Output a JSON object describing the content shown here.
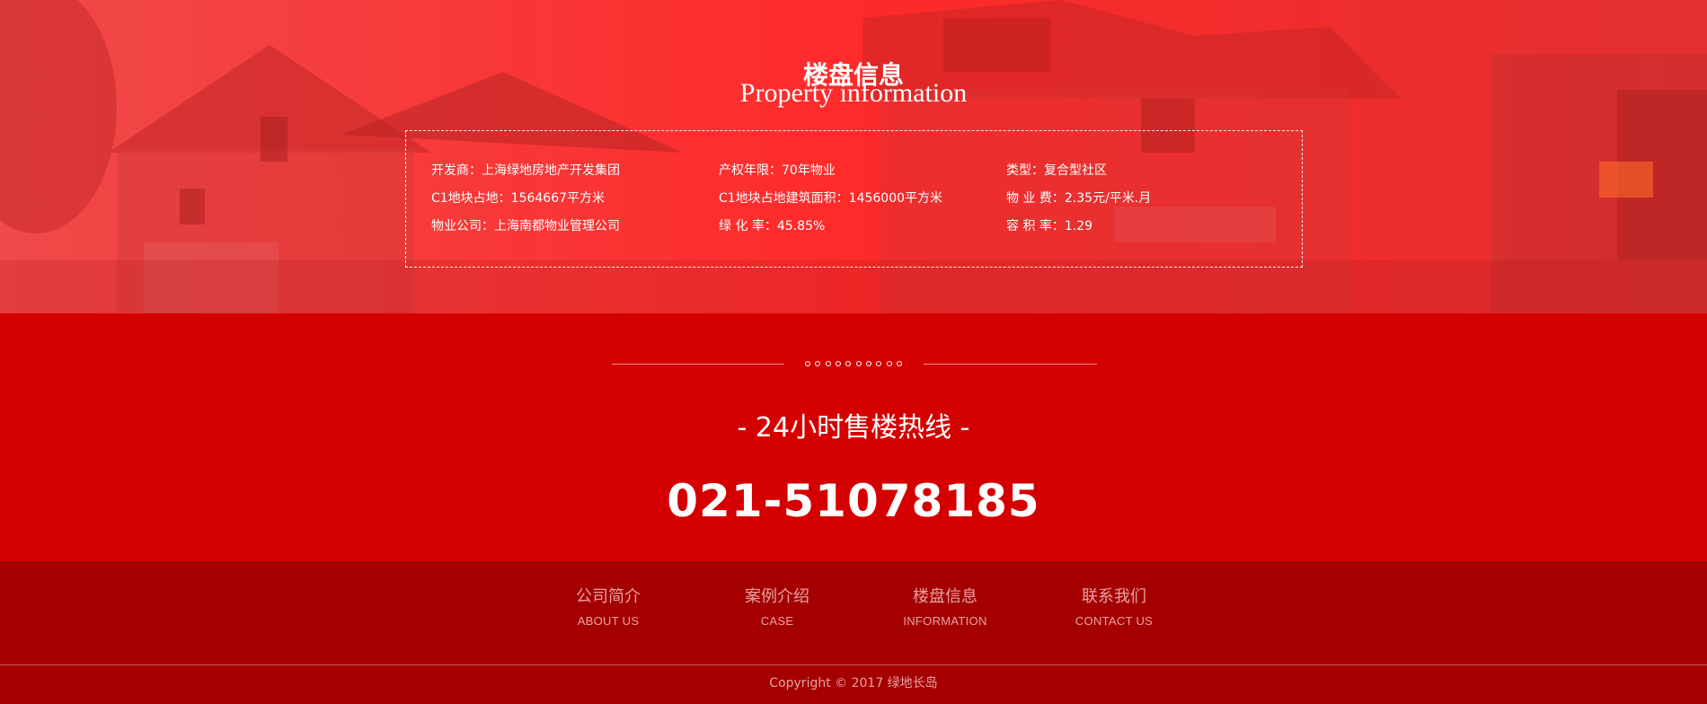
{
  "hero": {
    "title": "楼盘信息",
    "subtitle": "Property information",
    "info": [
      [
        "开发商：上海绿地房地产开发集团",
        "产权年限：70年物业",
        "类型：复合型社区"
      ],
      [
        "C1地块占地：1564667平方米",
        "C1地块占地建筑面积：1456000平方米",
        "物 业 费：2.35元/平米.月"
      ],
      [
        "物业公司：上海南都物业管理公司",
        "绿 化 率：45.85%",
        "容 积 率：1.29"
      ]
    ]
  },
  "hotline": {
    "label": "- 24小时售楼热线 -",
    "number": "021-51078185"
  },
  "footer": {
    "nav": [
      {
        "title": "公司简介",
        "sub": "ABOUT US"
      },
      {
        "title": "案例介绍",
        "sub": "CASE"
      },
      {
        "title": "楼盘信息",
        "sub": "INFORMATION"
      },
      {
        "title": "联系我们",
        "sub": "CONTACT US"
      }
    ],
    "copyright": "Copyright © 2017 绿地长岛"
  },
  "colors": {
    "hero_tint": "#ff3b3b",
    "hotline_bg": "#d40000",
    "footer_bg": "#a50000",
    "footer_text": "#e9a0a0"
  }
}
